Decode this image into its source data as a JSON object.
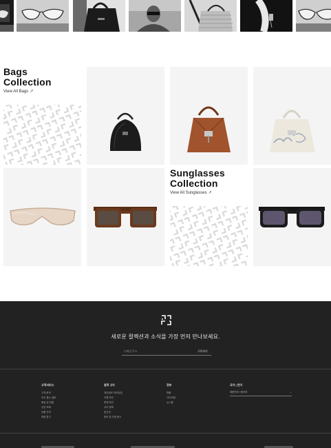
{
  "strip": {
    "tiles": [
      {
        "icon": "sunglasses-photo-icon"
      },
      {
        "icon": "sunglasses-photo-icon"
      },
      {
        "icon": "tote-bag-photo-icon"
      },
      {
        "icon": "model-portrait-photo-icon"
      },
      {
        "icon": "woven-bag-photo-icon"
      },
      {
        "icon": "bag-charm-photo-icon"
      },
      {
        "icon": "sunglasses-photo-icon"
      }
    ]
  },
  "bags": {
    "title": "Bags Collection",
    "title_line1": "Bags",
    "title_line2": "Collection",
    "link": "View All Bags",
    "link_arrow": "↗",
    "products": [
      {
        "icon": "black-dome-bag-icon"
      },
      {
        "icon": "brown-antigona-bag-icon"
      },
      {
        "icon": "white-printed-bag-icon"
      }
    ]
  },
  "sunglasses": {
    "title_line1": "Sunglasses",
    "title_line2": "Collection",
    "link": "View All Sunglasses",
    "link_arrow": "↗",
    "products": [
      {
        "icon": "beige-shield-sunglasses-icon"
      },
      {
        "icon": "tortoise-square-sunglasses-icon"
      },
      {
        "icon": "black-square-sunglasses-icon"
      }
    ]
  },
  "footer": {
    "logo": "4g-logo-icon",
    "newsletter_title": "새로운 컬렉션과 소식을 가장 먼저 만나보세요.",
    "email_placeholder": "이메일 주소",
    "subscribe_label": "구독하기",
    "columns": [
      {
        "heading": "고객서비스",
        "items": [
          "고객 문의",
          "자주 묻는 질문",
          "배송 및 반품",
          "주문 조회",
          "상품 관리",
          "매장 찾기"
        ]
      },
      {
        "heading": "법적 고지",
        "items": [
          "개인정보 처리방침",
          "이용 약관",
          "판매 약관",
          "쿠키 정책",
          "접근성",
          "윤리 및 규정 준수"
        ]
      },
      {
        "heading": "정보",
        "items": [
          "채용",
          "사이트맵",
          "뉴스룸"
        ]
      },
      {
        "heading": "국가 | 언어",
        "items": []
      }
    ],
    "country_value": "대한민국 / 한국어",
    "country_chevron": "⌄"
  },
  "colors": {
    "footer_bg": "#222222",
    "cell_bg": "#f4f4f4",
    "bag_brown": "#a0532c"
  }
}
